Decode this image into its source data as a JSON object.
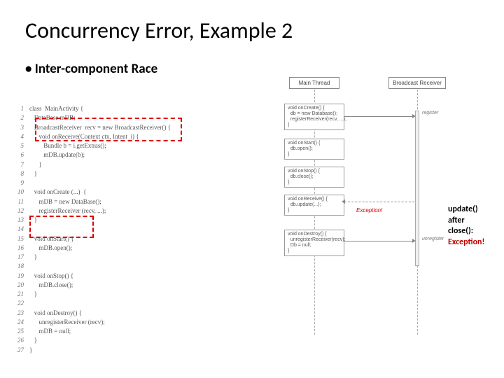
{
  "title": "Concurrency Error, Example 2",
  "bullet": "Inter-component Race",
  "code": {
    "l1": "class  MainActivity {",
    "l2": "   DataBase mDB;",
    "l3": "   BroadcastReceiver  recv = new BroadcastReceiver() {",
    "l4": "      void onReceive(Context ctx, Intent  i) {",
    "l5": "         Bundle b = i.getExtras();",
    "l6": "         mDB.update(b);",
    "l7": "      }",
    "l8": "   }",
    "l9": "",
    "l10": "   void onCreate (...)  {",
    "l11": "      mDB = new DataBase();",
    "l12": "      registerReceiver (recv, ...);",
    "l13": "   }",
    "l14": "",
    "l15": "   void onStart() {",
    "l16": "      mDB.open();",
    "l17": "   }",
    "l18": "",
    "l19": "   void onStop() {",
    "l20": "      mDB.close();",
    "l21": "   }",
    "l22": "",
    "l23": "   void onDestroy() {",
    "l24": "      unregisterReceiver (recv);",
    "l25": "      mDB = null;",
    "l26": "   }",
    "l27": "}"
  },
  "seq": {
    "header_main": "Main Thread",
    "header_recv": "Broadcast Receiver",
    "box_onCreate": "void onCreate() {\n  db = new Database();\n  registerReceiver(recv, ...);\n}",
    "box_onStart": "void onStart() {\n  db.open();\n}",
    "box_onStop": "void onStop() {\n  db.close();\n}",
    "box_onReceive": "void onReceive() {\n  db.update(...);\n}",
    "box_onDestroy": "void onDestroy() {\n  unregisterReceiver(recv);\n  Db = null;\n}",
    "label_register": "register",
    "label_unregister": "unregister",
    "label_exception": "Exception!"
  },
  "note": {
    "l1": "update()",
    "l2": "after",
    "l3": "close():",
    "l4": "Exception!"
  }
}
